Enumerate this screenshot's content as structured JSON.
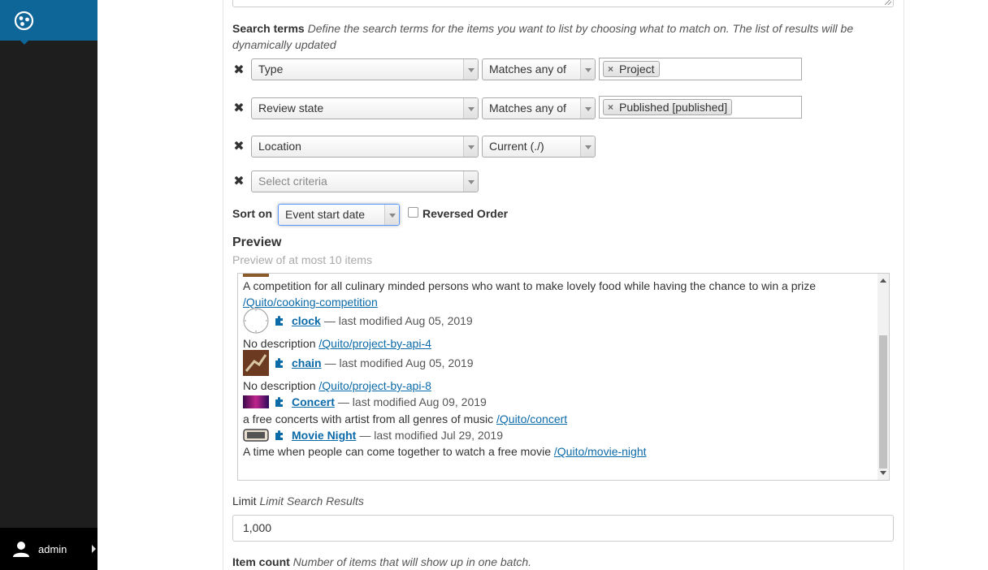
{
  "toolbar": {
    "user_name": "admin"
  },
  "search_terms": {
    "label": "Search terms",
    "help": "Define the search terms for the items you want to list by choosing what to match on. The list of results will be dynamically updated",
    "rows": [
      {
        "criteria": "Type",
        "operator": "Matches any of",
        "tag": "Project"
      },
      {
        "criteria": "Review state",
        "operator": "Matches any of",
        "tag": "Published [published]"
      },
      {
        "criteria": "Location",
        "operator": "Current (./)"
      }
    ],
    "new_criteria_placeholder": "Select criteria"
  },
  "sort": {
    "label": "Sort on",
    "value": "Event start date",
    "reversed_label": "Reversed Order"
  },
  "preview": {
    "title": "Preview",
    "subtitle": "Preview of at most 10 items",
    "items": [
      {
        "description": "A competition for all culinary minded persons who want to make lovely food while having the chance to win a prize",
        "path": "/Quito/cooking-competition"
      },
      {
        "title": "clock",
        "modified": "— last modified Aug 05, 2019",
        "description": "No description",
        "path": "/Quito/project-by-api-4"
      },
      {
        "title": "chain",
        "modified": "— last modified Aug 05, 2019",
        "description": "No description",
        "path": "/Quito/project-by-api-8"
      },
      {
        "title": "Concert",
        "modified": "— last modified Aug 09, 2019",
        "description": "a free concerts with artist from all genres of music",
        "path": "/Quito/concert"
      },
      {
        "title": "Movie Night",
        "modified": "— last modified Jul 29, 2019",
        "description": "A time when people can come together to watch a free movie",
        "path": "/Quito/movie-night"
      }
    ]
  },
  "limit": {
    "label": "Limit",
    "help": "Limit Search Results",
    "value": "1,000"
  },
  "item_count": {
    "label": "Item count",
    "help": "Number of items that will show up in one batch."
  },
  "colors": {
    "toolbar_bg": "#1e1e1e",
    "logo_bg": "#0e6597",
    "link": "#0b6aa8"
  },
  "icons": [
    "plone-logo-icon",
    "user-icon",
    "remove-criteria-icon",
    "puzzle-piece-icon",
    "dropdown-arrow-icon"
  ]
}
